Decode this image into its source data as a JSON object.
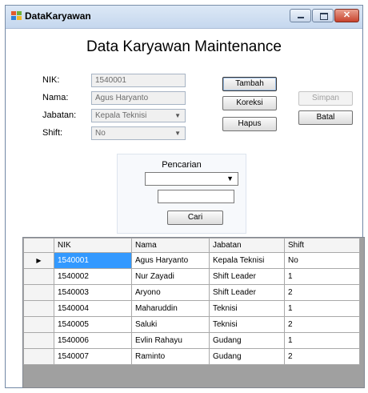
{
  "window": {
    "title": "DataKaryawan"
  },
  "form": {
    "heading": "Data Karyawan Maintenance",
    "nik_label": "NIK:",
    "nik_value": "1540001",
    "nama_label": "Nama:",
    "nama_value": "Agus Haryanto",
    "jabatan_label": "Jabatan:",
    "jabatan_value": "Kepala Teknisi",
    "shift_label": "Shift:",
    "shift_value": "No"
  },
  "buttons": {
    "tambah": "Tambah",
    "koreksi": "Koreksi",
    "hapus": "Hapus",
    "simpan": "Simpan",
    "batal": "Batal"
  },
  "search": {
    "title": "Pencarian",
    "dropdown_value": "",
    "text_value": "",
    "button": "Cari"
  },
  "table": {
    "columns": [
      "NIK",
      "Nama",
      "Jabatan",
      "Shift"
    ],
    "selected_row": 0,
    "rows": [
      [
        "1540001",
        "Agus Haryanto",
        "Kepala Teknisi",
        "No"
      ],
      [
        "1540002",
        "Nur Zayadi",
        "Shift Leader",
        "1"
      ],
      [
        "1540003",
        "Aryono",
        "Shift Leader",
        "2"
      ],
      [
        "1540004",
        "Maharuddin",
        "Teknisi",
        "1"
      ],
      [
        "1540005",
        "Saluki",
        "Teknisi",
        "2"
      ],
      [
        "1540006",
        "Evlin Rahayu",
        "Gudang",
        "1"
      ],
      [
        "1540007",
        "Raminto",
        "Gudang",
        "2"
      ]
    ]
  }
}
